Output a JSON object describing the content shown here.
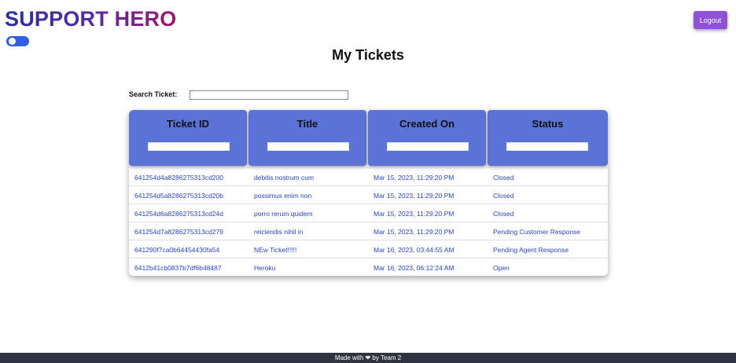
{
  "brand": {
    "title": "SUPPORT HERO"
  },
  "header": {
    "logout_label": "Logout"
  },
  "page": {
    "title": "My Tickets"
  },
  "search": {
    "label": "Search Ticket:",
    "value": "",
    "placeholder": ""
  },
  "table": {
    "columns": [
      "Ticket ID",
      "Title",
      "Created On",
      "Status"
    ],
    "rows": [
      [
        "641254d4a8286275313cd200",
        "debitis nostrum cum",
        "Mar 15, 2023, 11:29:20 PM",
        "Closed"
      ],
      [
        "641254d5a8286275313cd20b",
        "possimus enim non",
        "Mar 15, 2023, 11:29:20 PM",
        "Closed"
      ],
      [
        "641254d6a8286275313cd24d",
        "porro rerum quidem",
        "Mar 15, 2023, 11:29:20 PM",
        "Closed"
      ],
      [
        "641254d7a8286275313cd279",
        "reiciendis nihil in",
        "Mar 15, 2023, 11:29:20 PM",
        "Pending Customer Response"
      ],
      [
        "641290f7ca0b64454430fa54",
        "NEw Ticket!!!!!",
        "Mar 16, 2023, 03:44:55 AM",
        "Pending Agent Response"
      ],
      [
        "6412b41cb0837b7df6b48487",
        "Heroku",
        "Mar 16, 2023, 06:12:24 AM",
        "Open"
      ]
    ]
  },
  "footer": {
    "text": "Made with ❤ by Team 2"
  },
  "colors": {
    "accent": "#5b72d6",
    "logout": "#8e52d6",
    "toggle": "#2f5fe0",
    "footer": "#2e3440"
  }
}
